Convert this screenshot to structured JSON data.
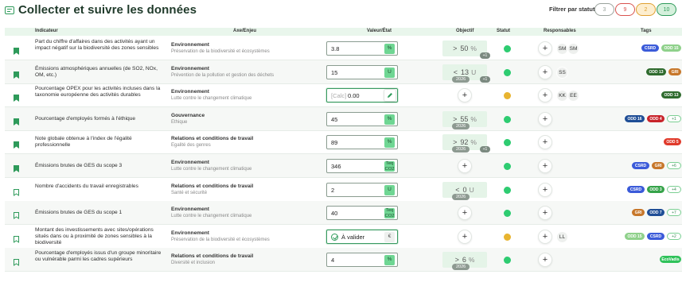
{
  "title": "Collecter et suivre les données",
  "filter": {
    "label": "Filtrer par statut :",
    "pills": [
      {
        "count": "3",
        "color": "#9aa39c",
        "bg": "#ffffff"
      },
      {
        "count": "9",
        "color": "#d9534f",
        "bg": "#ffffff"
      },
      {
        "count": "2",
        "color": "#e0a030",
        "bg": "#fdeecf"
      },
      {
        "count": "10",
        "color": "#2e9a5a",
        "bg": "#d5f0dc"
      }
    ]
  },
  "columns": {
    "indicateur": "Indicateur",
    "axe": "Axe/Enjeu",
    "valeur": "Valeur/État",
    "objectif": "Objectif",
    "statut": "Statut",
    "responsables": "Responsables",
    "tags": "Tags"
  },
  "colors": {
    "green": "#2ecc71",
    "yellow": "#e8b430",
    "csrd": "#3b5bd9",
    "odd15": "#8fd18b",
    "odd13": "#2f6b2e",
    "gri": "#c7772a",
    "odd16": "#1f4e96",
    "odd4": "#c8242b",
    "odd5": "#e03a2b",
    "odd3": "#36a34a",
    "ecovadis": "#2fc25a"
  },
  "rows": [
    {
      "text": "Part du chiffre d'affaires dans des activités ayant un impact négatif sur la biodiversité des zones sensibles",
      "category": "Environnement",
      "subcategory": "Préservation de la biodiversité et écosystèmes",
      "value": "3.8",
      "unit": "%",
      "objective": {
        "op": ">",
        "val": "50",
        "unit": "%",
        "year": "",
        "extra": "+1"
      },
      "status": "green",
      "responsables": [
        "SM",
        "SM"
      ],
      "bookmark_filled": true,
      "tags": [
        {
          "label": "CSRD",
          "color": "#3b5bd9"
        },
        {
          "label": "ODD 15",
          "color": "#8fd18b"
        }
      ]
    },
    {
      "text": "Émissions atmosphériques annuelles (de SO2, NOx, OM, etc.)",
      "category": "Environnement",
      "subcategory": "Prévention de la pollution et gestion des déchets",
      "value": "15",
      "unit": "U",
      "objective": {
        "op": "<",
        "val": "13",
        "unit": "U",
        "year": "2026",
        "extra": "+1"
      },
      "status": "green",
      "responsables": [
        "SS"
      ],
      "bookmark_filled": true,
      "tags": [
        {
          "label": "ODD 13",
          "color": "#2f6b2e"
        },
        {
          "label": "GRI",
          "color": "#c7772a"
        }
      ]
    },
    {
      "text": "Pourcentage OPEX pour les activités incluses dans la taxonomie européenne des activités durables",
      "category": "Environnement",
      "subcategory": "Lutte contre le changement climatique",
      "value": "0.00",
      "calc": "[Calc]",
      "unit": "%",
      "objective": null,
      "status": "yellow",
      "responsables": [
        "KK",
        "EE"
      ],
      "bookmark_filled": true,
      "tags": [
        {
          "label": "ODD 13",
          "color": "#2f6b2e"
        }
      ]
    },
    {
      "text": "Pourcentage d'employés formés à l'éthique",
      "category": "Gouvernance",
      "subcategory": "Ethique",
      "value": "45",
      "unit": "%",
      "objective": {
        "op": ">",
        "val": "55",
        "unit": "%",
        "year": "2026",
        "extra": ""
      },
      "status": "green",
      "responsables": [],
      "bookmark_filled": true,
      "tags": [
        {
          "label": "ODD 16",
          "color": "#1f4e96"
        },
        {
          "label": "ODD 4",
          "color": "#c8242b"
        },
        {
          "label": "+1",
          "color": "more"
        }
      ]
    },
    {
      "text": "Note globale obtenue à l'index de l'égalité professionnelle",
      "category": "Relations et conditions de travail",
      "subcategory": "Egalité des genres",
      "value": "89",
      "unit": "%",
      "objective": {
        "op": ">",
        "val": "92",
        "unit": "%",
        "year": "2026",
        "extra": "+1"
      },
      "status": "green",
      "responsables": [],
      "bookmark_filled": true,
      "tags": [
        {
          "label": "ODD 5",
          "color": "#e03a2b"
        }
      ]
    },
    {
      "text": "Émissions brutes de GES du scope 3",
      "category": "Environnement",
      "subcategory": "Lutte contre le changement climatique",
      "value": "346",
      "unit": "Teq CO2",
      "objective": null,
      "status": "green",
      "responsables": [],
      "bookmark_filled": true,
      "tags": [
        {
          "label": "CSRD",
          "color": "#3b5bd9"
        },
        {
          "label": "GRI",
          "color": "#c7772a"
        },
        {
          "label": "+6",
          "color": "more"
        }
      ]
    },
    {
      "text": "Nombre d'accidents du travail enregistrables",
      "category": "Relations et conditions de travail",
      "subcategory": "Santé et sécurité",
      "value": "2",
      "unit": "U",
      "objective": {
        "op": "<",
        "val": "0",
        "unit": "U",
        "year": "2026",
        "extra": ""
      },
      "status": "green",
      "responsables": [],
      "bookmark_filled": false,
      "tags": [
        {
          "label": "CSRD",
          "color": "#3b5bd9"
        },
        {
          "label": "ODD 3",
          "color": "#36a34a"
        },
        {
          "label": "+4",
          "color": "more"
        }
      ]
    },
    {
      "text": "Émissions brutes de GES du scope 1",
      "category": "Environnement",
      "subcategory": "Lutte contre le changement climatique",
      "value": "40",
      "unit": "Teq CO2",
      "objective": null,
      "status": "green",
      "responsables": [],
      "bookmark_filled": false,
      "tags": [
        {
          "label": "GRI",
          "color": "#c7772a"
        },
        {
          "label": "ODD 7",
          "color": "#1f4e96"
        },
        {
          "label": "+7",
          "color": "more"
        }
      ]
    },
    {
      "text": "Montant des investissements avec sites/opérations situés dans ou à proximité de zones sensibles à la biodiversité",
      "category": "Environnement",
      "subcategory": "Préservation de la biodiversité et écosystèmes",
      "value": "À valider",
      "unit": "€",
      "pending": true,
      "objective": null,
      "status": "yellow",
      "responsables": [
        "LL"
      ],
      "bookmark_filled": false,
      "tags": [
        {
          "label": "ODD 15",
          "color": "#8fd18b"
        },
        {
          "label": "CSRD",
          "color": "#3b5bd9"
        },
        {
          "label": "+2",
          "color": "more"
        }
      ]
    },
    {
      "text": "Pourcentage d'employés issus d'un groupe minoritaire ou vulnérable parmi les cadres supérieurs",
      "category": "Relations et conditions de travail",
      "subcategory": "Diversité et inclusion",
      "value": "4",
      "unit": "%",
      "objective": {
        "op": ">",
        "val": "6",
        "unit": "%",
        "year": "2026",
        "extra": ""
      },
      "status": "green",
      "responsables": [],
      "bookmark_filled": false,
      "tags": [
        {
          "label": "EcoVadis",
          "color": "#2fc25a"
        }
      ]
    }
  ]
}
